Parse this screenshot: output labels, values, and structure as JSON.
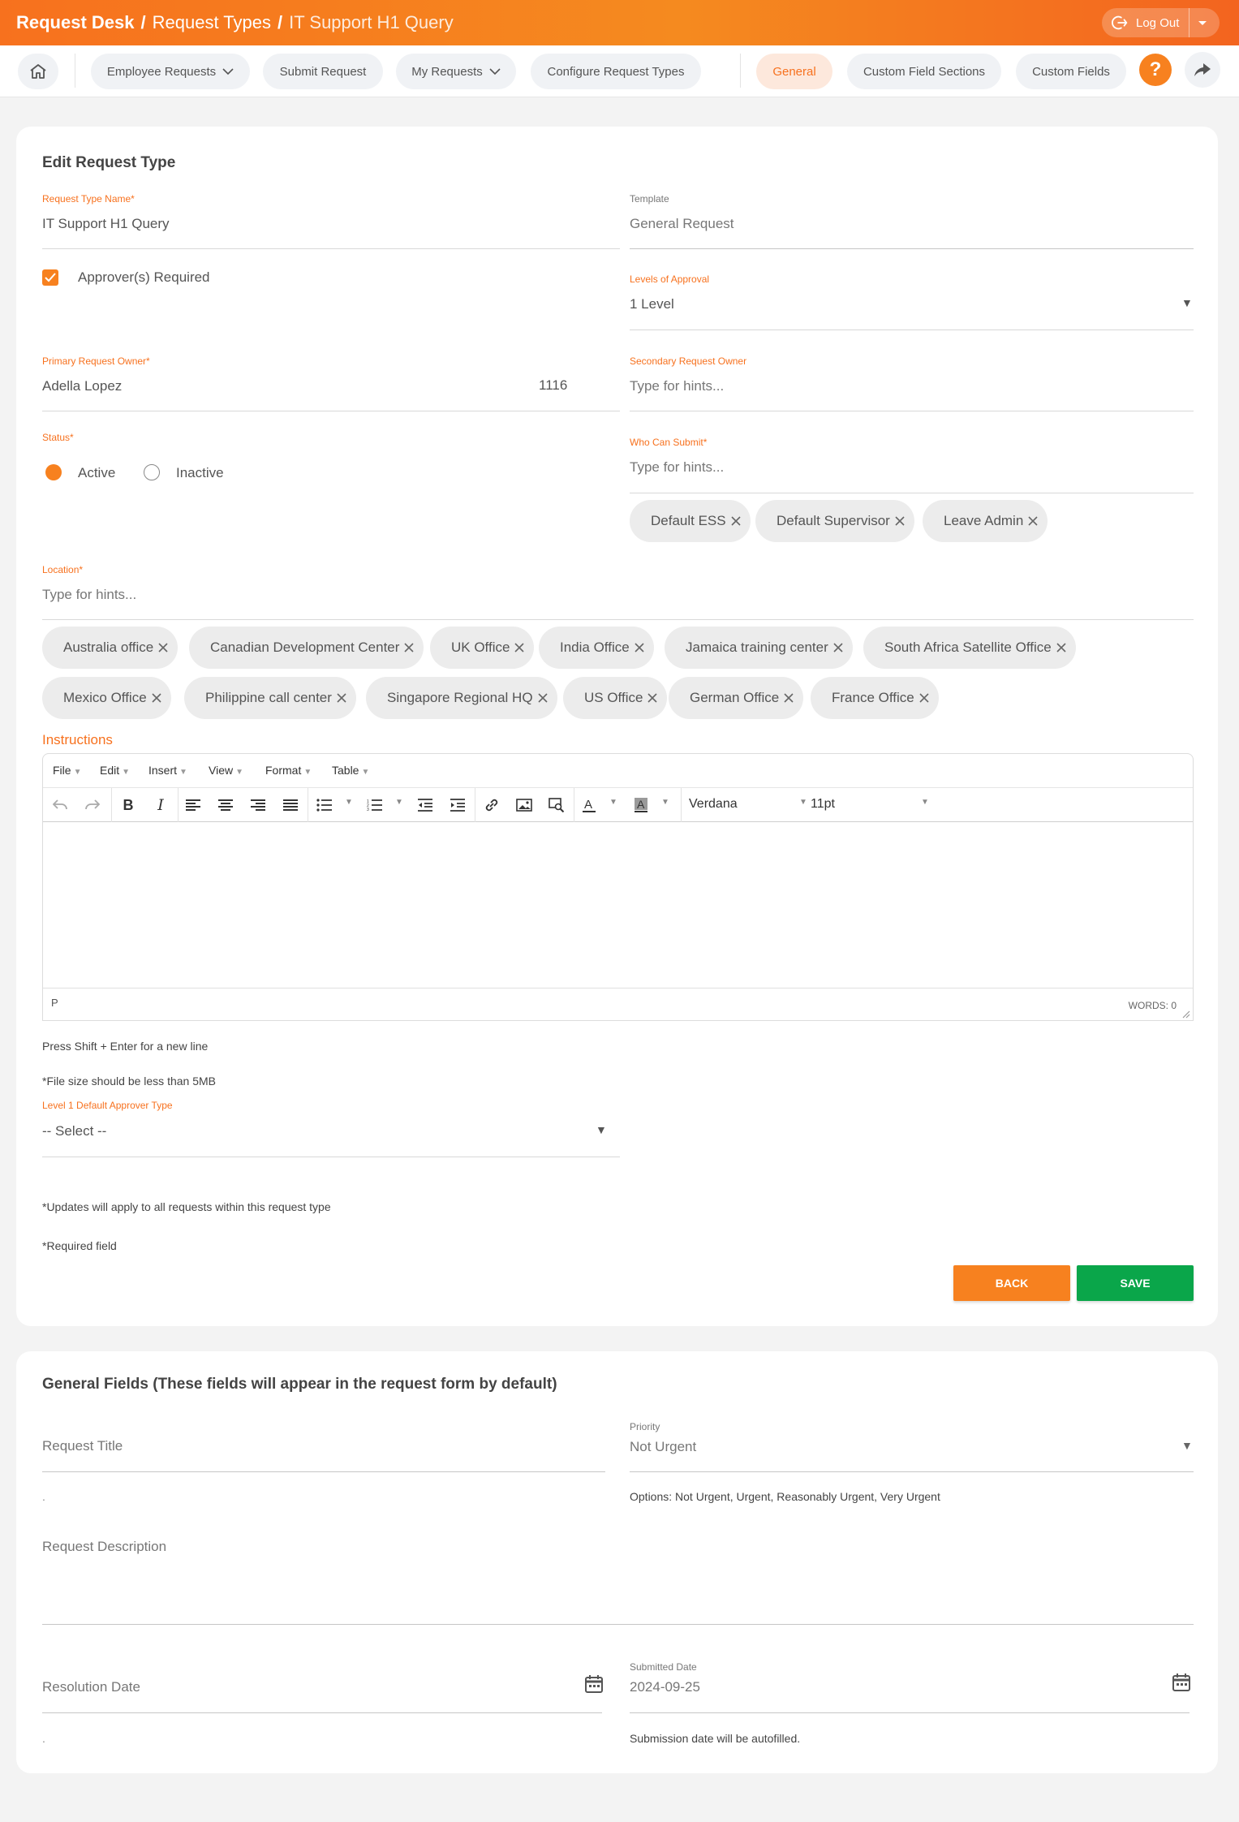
{
  "header": {
    "crumb1": "Request Desk",
    "crumb2": "Request Types",
    "crumb3": "IT Support H1 Query",
    "separator": "/",
    "logout_label": "Log Out"
  },
  "nav": {
    "employee_requests": "Employee Requests",
    "submit_request": "Submit Request",
    "my_requests": "My Requests",
    "configure_request_types": "Configure Request Types",
    "general": "General",
    "custom_field_sections": "Custom Field Sections",
    "custom_fields": "Custom Fields",
    "help": "?"
  },
  "edit": {
    "title": "Edit Request Type",
    "request_type_name_label": "Request Type Name",
    "request_type_name_value": "IT Support H1 Query",
    "template_label": "Template",
    "template_value": "General Request",
    "approvers_required_label": "Approver(s) Required",
    "levels_label": "Levels of Approval",
    "levels_value": "1 Level",
    "primary_owner_label": "Primary Request Owner",
    "primary_owner_value": "Adella Lopez",
    "primary_owner_id": "1116",
    "secondary_owner_label": "Secondary Request Owner",
    "secondary_owner_placeholder": "Type for hints...",
    "status_label": "Status",
    "status_active": "Active",
    "status_inactive": "Inactive",
    "who_can_submit_label": "Who Can Submit",
    "who_can_submit_placeholder": "Type for hints...",
    "who_can_submit_chips": [
      "Default ESS",
      "Default Supervisor",
      "Leave Admin"
    ],
    "location_label": "Location",
    "location_placeholder": "Type for hints...",
    "location_chips": [
      "Australia office",
      "Canadian Development Center",
      "UK Office",
      "India Office",
      "Jamaica training center",
      "South Africa Satellite Office",
      "Mexico Office",
      "Philippine call center",
      "Singapore Regional HQ",
      "US Office",
      "German Office",
      "France Office"
    ],
    "instructions_label": "Instructions",
    "required_mark": "*"
  },
  "editor": {
    "menus": [
      "File",
      "Edit",
      "Insert",
      "View",
      "Format",
      "Table"
    ],
    "font_family": "Verdana",
    "font_size": "11pt",
    "status_path": "P",
    "word_count": "WORDS: 0"
  },
  "notes": {
    "shift_enter": "Press Shift + Enter for a new line",
    "file_size": "*File size should be less than 5MB",
    "level1_label": "Level 1 Default Approver Type",
    "level1_value": "-- Select --",
    "updates_apply": "*Updates will apply to all requests within this request type",
    "required_field": "Required field"
  },
  "buttons": {
    "back": "BACK",
    "save": "SAVE"
  },
  "general_fields": {
    "title": "General Fields (These fields will appear in the request form by default)",
    "request_title": "Request Title",
    "priority_label": "Priority",
    "priority_value": "Not Urgent",
    "priority_options": "Options: Not Urgent, Urgent, Reasonably Urgent, Very Urgent",
    "dot": ".",
    "request_description": "Request Description",
    "resolution_date": "Resolution Date",
    "submitted_date_label": "Submitted Date",
    "submitted_date_value": "2024-09-25",
    "submission_note": "Submission date will be autofilled."
  },
  "colors": {
    "accent": "#f7711e",
    "save": "#0aa64a"
  }
}
